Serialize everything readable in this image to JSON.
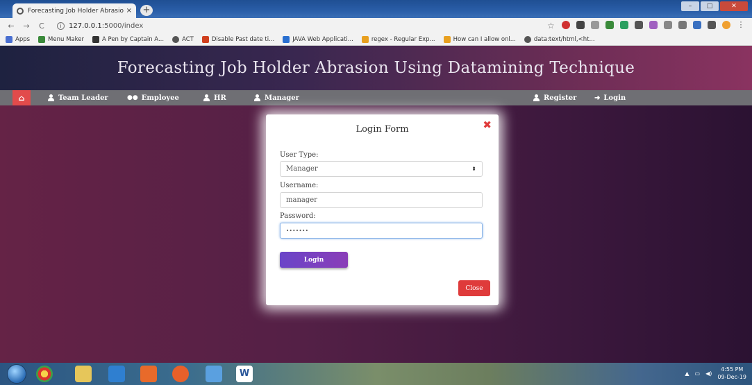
{
  "browser": {
    "tab_title": "Forecasting Job Holder Abrasion",
    "tab_close": "×",
    "new_tab": "+",
    "url_host": "127.0.0.1",
    "url_rest": ":5000/index",
    "bookmarks": [
      {
        "label": "Apps",
        "color": "#4a6fd0"
      },
      {
        "label": "Menu Maker",
        "color": "#3b8a3b"
      },
      {
        "label": "A Pen by Captain A...",
        "color": "#333333"
      },
      {
        "label": "ACT",
        "color": "#555555"
      },
      {
        "label": "Disable Past date ti...",
        "color": "#d0401f"
      },
      {
        "label": "JAVA Web Applicati...",
        "color": "#2a6fd0"
      },
      {
        "label": "regex - Regular Exp...",
        "color": "#e8a020"
      },
      {
        "label": "How can I allow onl...",
        "color": "#e8a020"
      },
      {
        "label": "data:text/html,<ht...",
        "color": "#555555"
      }
    ]
  },
  "page": {
    "title": "Forecasting Job Holder Abrasion Using Datamining Technique",
    "nav": {
      "team_leader": "Team Leader",
      "employee": "Employee",
      "hr": "HR",
      "manager": "Manager",
      "register": "Register",
      "login": "Login"
    }
  },
  "modal": {
    "title": "Login Form",
    "close_icon": "✖",
    "user_type_label": "User Type:",
    "user_type_value": "Manager",
    "username_label": "Username:",
    "username_value": "manager",
    "password_label": "Password:",
    "password_value": "•••••••",
    "login_button": "Login",
    "close_button": "Close"
  },
  "taskbar": {
    "time": "4:55 PM",
    "date": "09-Dec-19"
  },
  "colors": {
    "login_accent": "#6a45c8",
    "danger": "#df3b3b",
    "nav_bg": "#6f6f74"
  }
}
